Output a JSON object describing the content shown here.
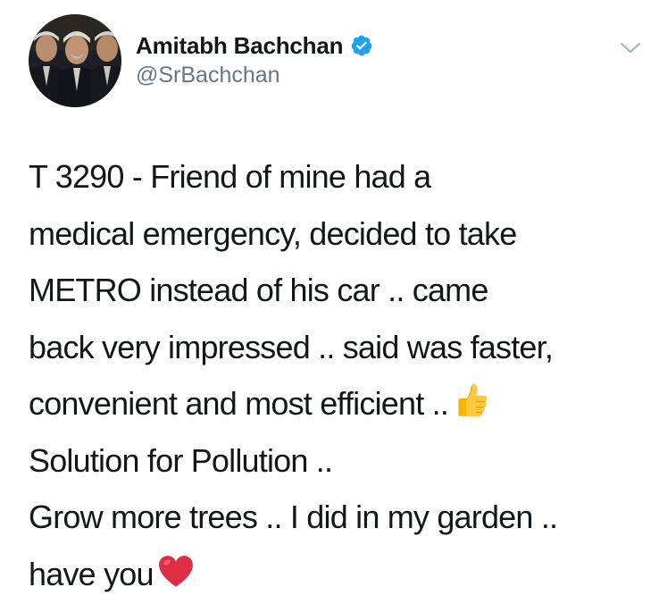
{
  "tweet": {
    "author": {
      "display_name": "Amitabh Bachchan",
      "handle": "@SrBachchan",
      "verified": true,
      "avatar_icon": "profile-photo"
    },
    "menu_icon": "chevron-down-icon",
    "text_lines": [
      "T 3290 - Friend of mine had a",
      "medical emergency, decided to take",
      "METRO instead of his car .. came",
      "back very impressed .. said was faster,",
      "convenient and most efficient ..",
      "Solution for Pollution ..",
      "Grow more trees .. I did in my garden ..",
      "have you"
    ],
    "emojis": {
      "thumbs_up": "thumbs-up-emoji",
      "heart": "red-heart-emoji"
    },
    "colors": {
      "text": "#14171a",
      "secondary": "#657786",
      "verified_blue": "#1da1f2",
      "chevron": "#aab8c2"
    }
  }
}
